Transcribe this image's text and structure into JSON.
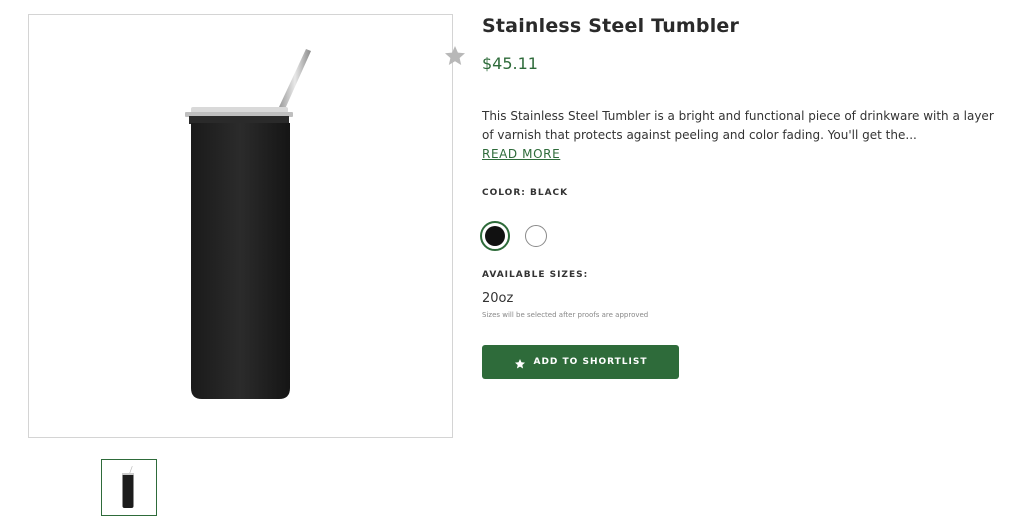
{
  "product": {
    "title": "Stainless Steel Tumbler",
    "price": "$45.11",
    "description": "This Stainless Steel Tumbler is a bright and functional piece of drinkware with a layer of varnish that protects against peeling and color fading. You'll get the...",
    "read_more_label": "READ MORE"
  },
  "color": {
    "label": "COLOR: BLACK",
    "options": [
      "black",
      "white"
    ],
    "selected": "black",
    "colors": {
      "black": "#111111",
      "white": "#ffffff",
      "selected_ring": "#2e6b3a"
    }
  },
  "sizes": {
    "label": "AVAILABLE SIZES:",
    "value": "20oz",
    "note": "Sizes will be selected after proofs are approved"
  },
  "actions": {
    "add_to_shortlist_label": "ADD TO SHORTLIST",
    "add_icon": "star-icon",
    "favorite_icon": "star-icon"
  },
  "theme": {
    "accent": "#2e6b3a",
    "text": "#2b2b2b"
  }
}
